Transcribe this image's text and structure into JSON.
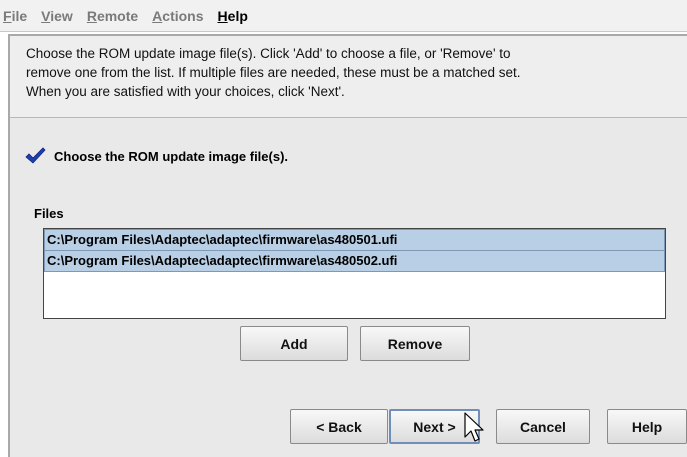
{
  "menu": [
    {
      "mnemonic": "F",
      "rest": "ile"
    },
    {
      "mnemonic": "V",
      "rest": "iew"
    },
    {
      "mnemonic": "R",
      "rest": "emote"
    },
    {
      "mnemonic": "A",
      "rest": "ctions"
    },
    {
      "mnemonic": "H",
      "rest": "elp"
    }
  ],
  "instructions": [
    "Choose the ROM update image file(s).  Click 'Add' to choose a file, or 'Remove' to",
    "remove one from the list.  If multiple files are needed, these must be a matched set.",
    "When you are satisfied with your choices, click 'Next'."
  ],
  "step": {
    "icon": "checkmark-icon",
    "title": "Choose the ROM update image file(s)."
  },
  "files": {
    "label": "Files",
    "items": [
      "C:\\Program Files\\Adaptec\\adaptec\\firmware\\as480501.ufi",
      "C:\\Program Files\\Adaptec\\adaptec\\firmware\\as480502.ufi"
    ]
  },
  "buttons": {
    "add": "Add",
    "remove": "Remove",
    "back": "< Back",
    "next": "Next >",
    "cancel": "Cancel",
    "help": "Help"
  },
  "colors": {
    "selection": "#b8cfe5",
    "check": "#1f3fb0",
    "panel": "#eeeeee"
  }
}
